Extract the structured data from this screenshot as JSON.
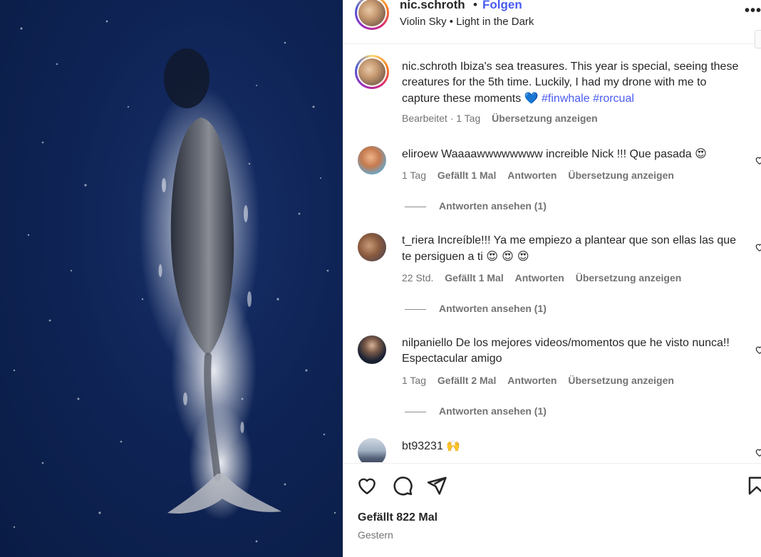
{
  "header": {
    "username": "nic.schroth",
    "separator": "•",
    "follow_label": "Folgen",
    "music": "Violin Sky • Light in the Dark",
    "more_icon": "more-horizontal-icon"
  },
  "caption": {
    "username": "nic.schroth",
    "text": "Ibiza's sea treasures. This year is special, seeing these creatures for the 5th time. Luckily, I had my drone with me to capture these moments",
    "emoji": "💙",
    "hashtags": [
      "#finwhale",
      "#rorcual"
    ],
    "edited": "Bearbeitet · 1 Tag",
    "translate": "Übersetzung anzeigen"
  },
  "comments": [
    {
      "username": "eliroew",
      "text": "Waaaawwwwwwww increible Nick !!! Que pasada",
      "emoji": "😍",
      "time": "1 Tag",
      "likes": "Gefällt 1 Mal",
      "reply": "Antworten",
      "translate": "Übersetzung anzeigen",
      "view_replies": "Antworten ansehen (1)"
    },
    {
      "username": "t_riera",
      "text": "Increíble!!! Ya me empiezo a plantear que son ellas las que te persiguen a ti",
      "emoji": "😍 😍 😍",
      "time": "22 Std.",
      "likes": "Gefällt 1 Mal",
      "reply": "Antworten",
      "translate": "Übersetzung anzeigen",
      "view_replies": "Antworten ansehen (1)"
    },
    {
      "username": "nilpaniello",
      "text": "De los mejores videos/momentos que he visto nunca!! Espectacular amigo",
      "emoji": "",
      "time": "1 Tag",
      "likes": "Gefällt 2 Mal",
      "reply": "Antworten",
      "translate": "Übersetzung anzeigen",
      "view_replies": "Antworten ansehen (1)"
    },
    {
      "username": "bt93231",
      "text": "",
      "emoji": "🙌",
      "time": "",
      "likes": "",
      "reply": "",
      "translate": "",
      "view_replies": ""
    }
  ],
  "footer": {
    "likes": "Gefällt 822 Mal",
    "date": "Gestern",
    "icons": [
      "heart-icon",
      "comment-icon",
      "share-icon",
      "save-icon"
    ]
  }
}
